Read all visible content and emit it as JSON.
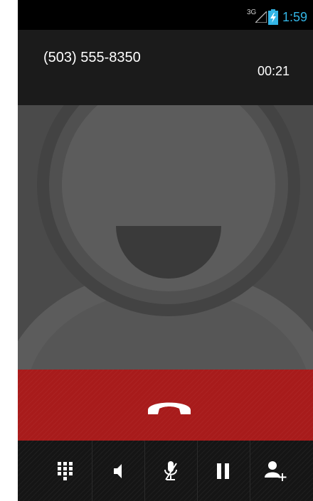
{
  "status_bar": {
    "network": "3G",
    "time": "1:59",
    "time_color": "#33b5e5"
  },
  "call": {
    "number": "(503) 555-8350",
    "timer": "00:21"
  },
  "colors": {
    "end_call": "#a81b1b",
    "controls_bg": "#151515",
    "photo_bg": "#4a4a4a"
  },
  "controls": [
    {
      "name": "dialpad",
      "icon": "dialpad-icon"
    },
    {
      "name": "speaker",
      "icon": "speaker-icon"
    },
    {
      "name": "mute",
      "icon": "mic-mute-icon"
    },
    {
      "name": "hold",
      "icon": "pause-icon"
    },
    {
      "name": "add-call",
      "icon": "add-person-icon"
    }
  ]
}
